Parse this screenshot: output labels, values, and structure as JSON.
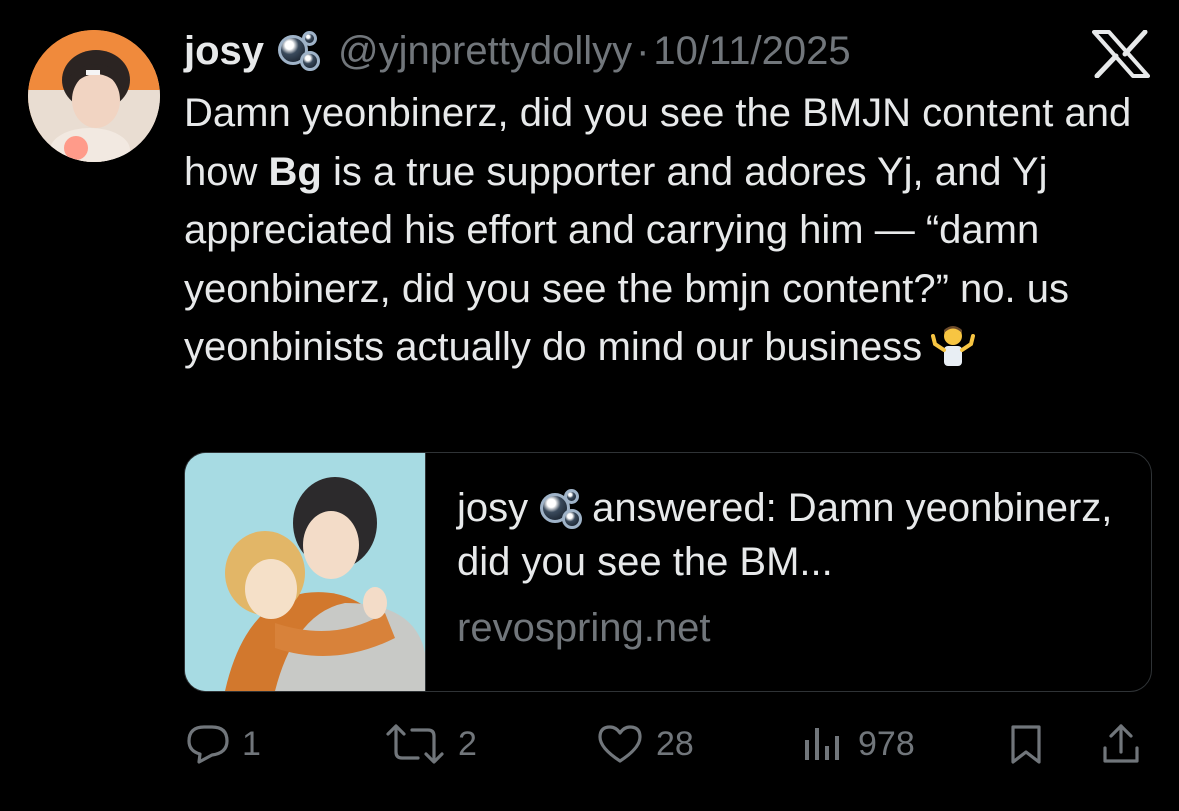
{
  "author": {
    "name": "josy",
    "handle": "@yjnprettydollyy",
    "separator": "·",
    "date": "10/11/2025"
  },
  "tweet": {
    "part1": "Damn yeonbinerz, did you see the BMJN content and how ",
    "bold": "Bg",
    "part2": " is a true supporter and adores Yj, and Yj appreciated his effort and carrying him — “damn yeonbinerz, did you see the bmjn content?” no. us yeonbinists actually do mind our business",
    "emoji": "person-shrugging-emoji"
  },
  "card": {
    "name": "josy",
    "title_rest": "answered: Damn yeonbinerz, did you see the BM...",
    "domain": "revospring.net"
  },
  "actions": {
    "replies": "1",
    "reposts": "2",
    "likes": "28",
    "views": "978"
  },
  "icons": [
    "bubbles-emoji",
    "x-logo-icon",
    "reply-icon",
    "repost-icon",
    "like-icon",
    "views-icon",
    "bookmark-icon",
    "share-icon"
  ],
  "colors": {
    "background": "#000000",
    "text": "#e7e9ea",
    "muted": "#71767b",
    "border": "#2f3336"
  }
}
